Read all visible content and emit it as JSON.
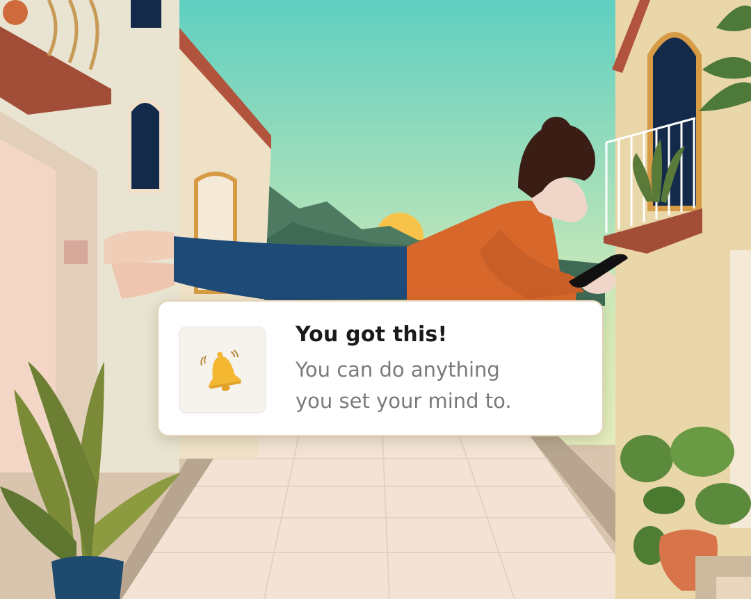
{
  "notification": {
    "title": "You got this!",
    "body_lines": [
      "You can do anything",
      "you set your mind to."
    ],
    "icon": "bell-icon"
  },
  "colors": {
    "sky_top": "#5fcfc0",
    "sky_bottom": "#f7f0c6",
    "sun": "#f7c34a",
    "bell": "#f3b731",
    "shirt": "#d8672b",
    "pants": "#1e4a78",
    "roof": "#b1533d"
  }
}
